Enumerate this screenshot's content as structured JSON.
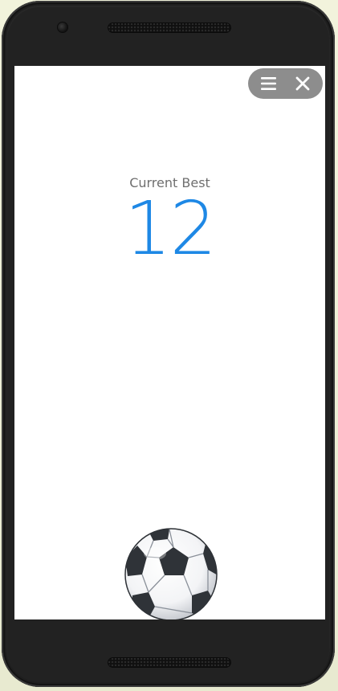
{
  "game": {
    "best_label": "Current Best",
    "best_score": "12",
    "score_color": "#1e88e5"
  },
  "toolbar": {
    "menu_icon": "hamburger-menu-icon",
    "close_icon": "close-icon"
  },
  "ball": {
    "icon": "soccer-ball-icon"
  }
}
